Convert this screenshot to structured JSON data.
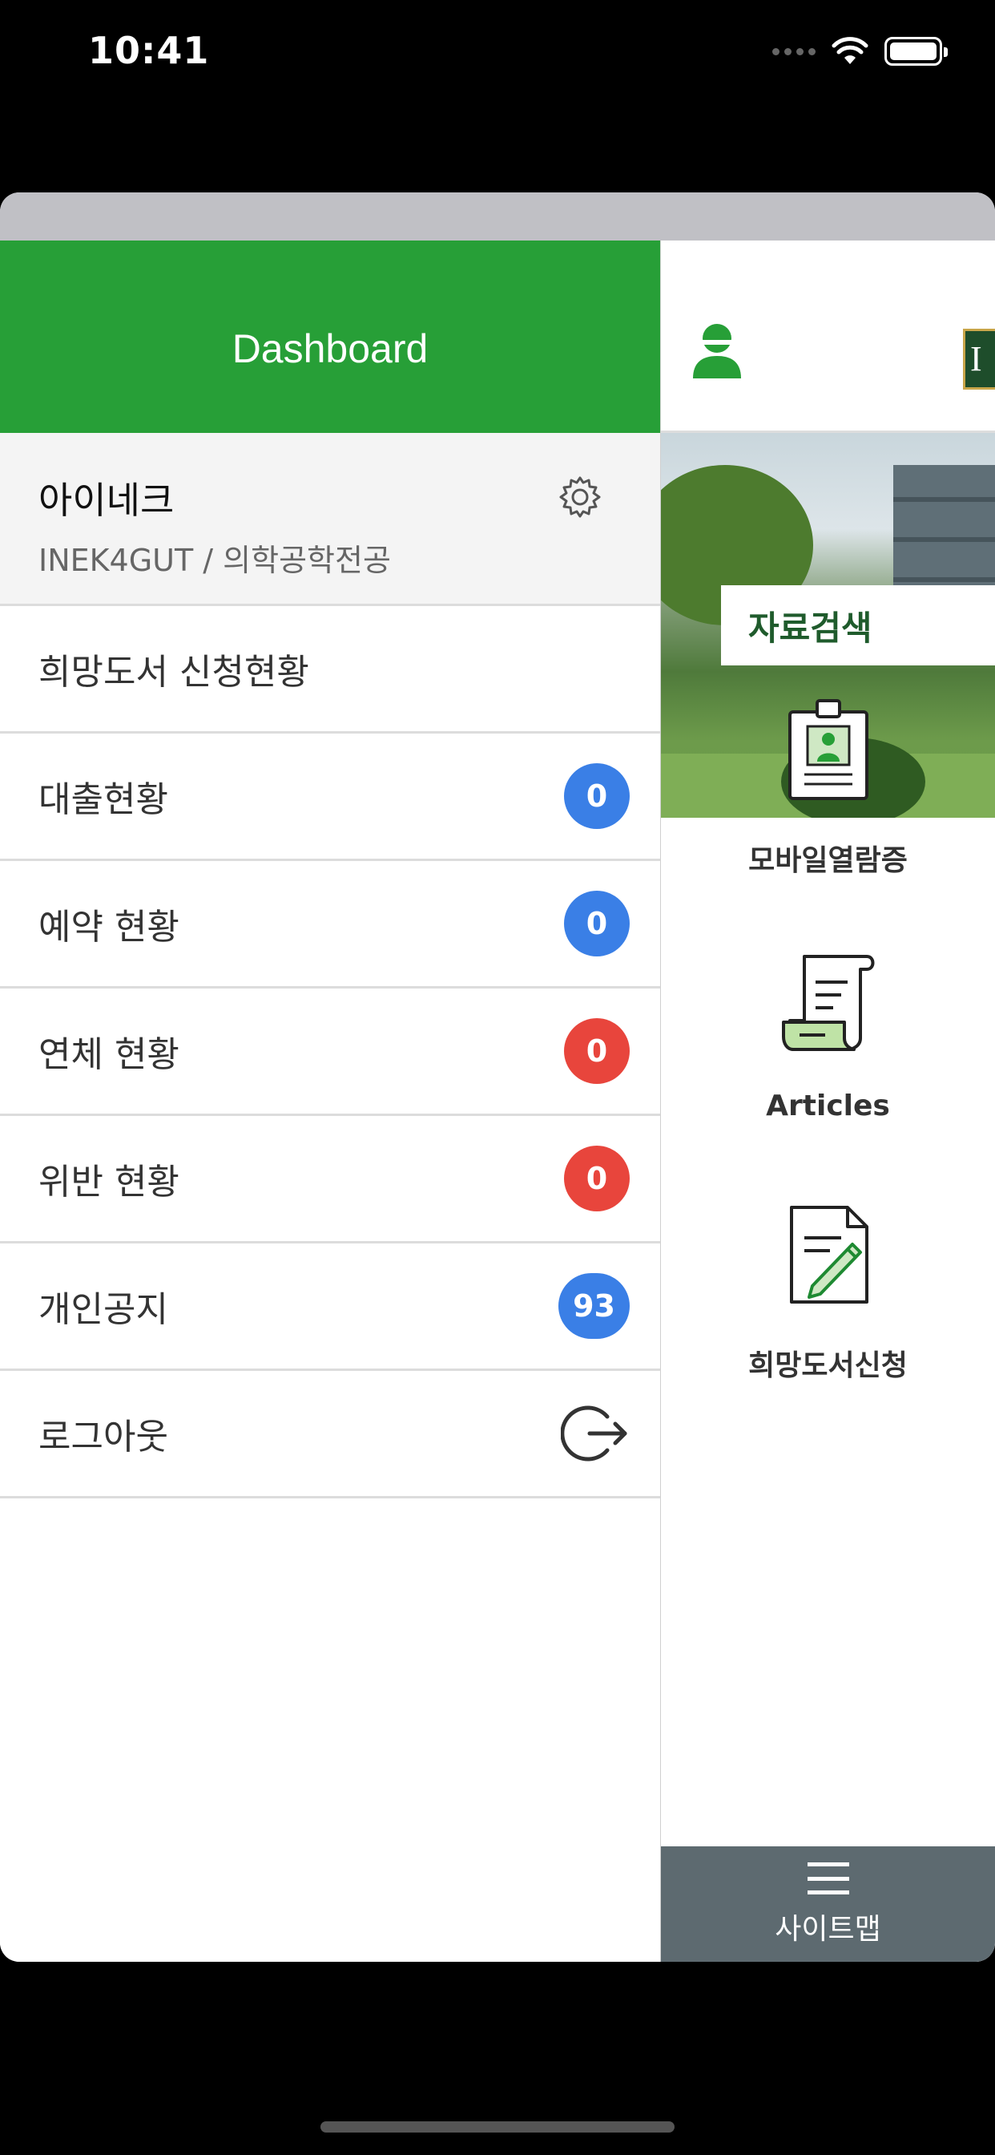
{
  "status_bar": {
    "time": "10:41"
  },
  "drawer": {
    "title": "Dashboard",
    "profile": {
      "name": "아이네크",
      "sub": "INEK4GUT / 의학공학전공"
    },
    "items": [
      {
        "label": "희망도서 신청현황"
      },
      {
        "label": "대출현황",
        "badge": "0",
        "badge_color": "#3a7fe6"
      },
      {
        "label": "예약 현황",
        "badge": "0",
        "badge_color": "#3a7fe6"
      },
      {
        "label": "연체 현황",
        "badge": "0",
        "badge_color": "#e8453c"
      },
      {
        "label": "위반 현황",
        "badge": "0",
        "badge_color": "#e8453c"
      },
      {
        "label": "개인공지",
        "badge": "93",
        "badge_color": "#3a7fe6"
      },
      {
        "label": "로그아웃",
        "icon": "logout-icon"
      }
    ]
  },
  "main": {
    "logo_letter": "I",
    "search_label": "자료검색",
    "quick_links": [
      {
        "label": "모바일열람증",
        "icon": "mobile-id-card-icon"
      },
      {
        "label": "Articles",
        "icon": "scroll-document-icon"
      },
      {
        "label": "희망도서신청",
        "icon": "document-pen-icon"
      }
    ],
    "sitemap_label": "사이트맵"
  },
  "colors": {
    "drawer_header": "#279f37",
    "accent_green": "#1f5b2c",
    "sitemap_bar": "#5d6a70"
  }
}
